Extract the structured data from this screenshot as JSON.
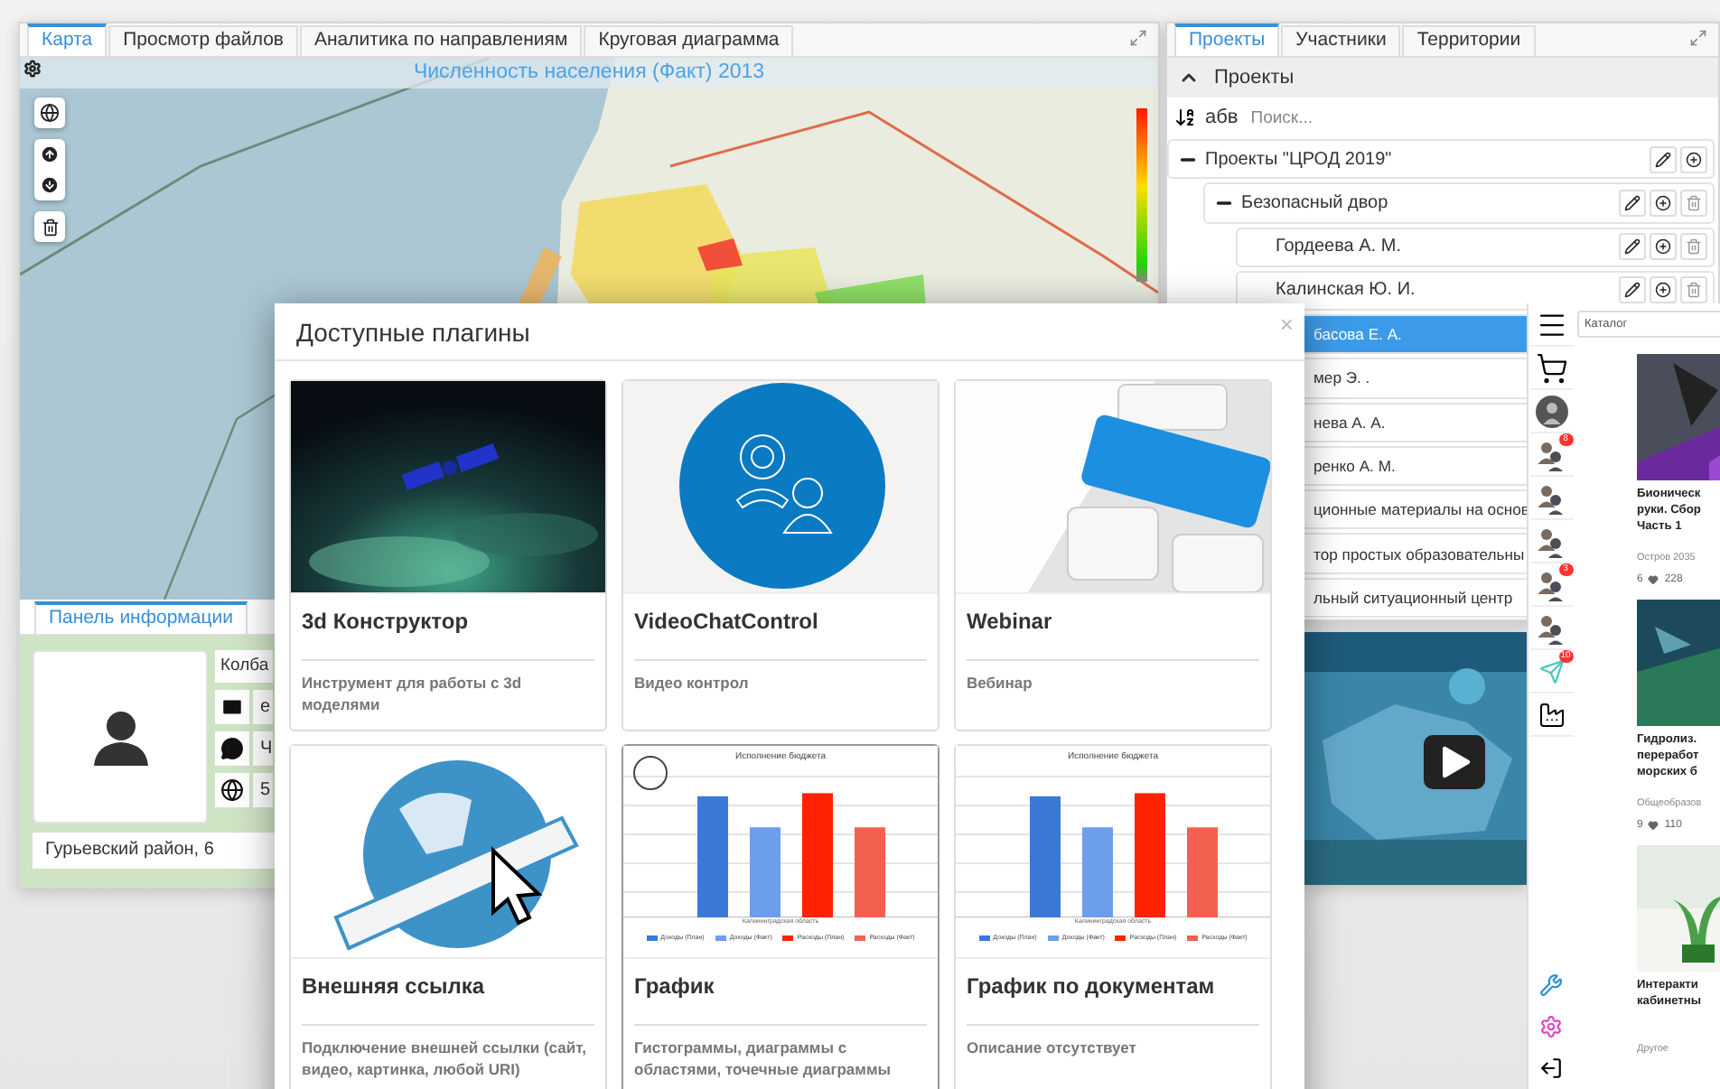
{
  "left_window": {
    "tabs": [
      {
        "label": "Карта",
        "selected": true
      },
      {
        "label": "Просмотр файлов",
        "selected": false
      },
      {
        "label": "Аналитика по направлениям",
        "selected": false
      },
      {
        "label": "Круговая диаграмма",
        "selected": false
      }
    ],
    "map": {
      "title": "Численность населения (Факт) 2013"
    },
    "info_panel": {
      "tab": "Панель информации",
      "name": "Колба",
      "fields": [
        {
          "kind": "email",
          "value": "e"
        },
        {
          "kind": "chat",
          "value": "Ч"
        },
        {
          "kind": "web",
          "value": "5"
        }
      ],
      "address": "Гурьевский район, 6"
    }
  },
  "right_window": {
    "tabs": [
      {
        "label": "Проекты",
        "selected": true
      },
      {
        "label": "Участники",
        "selected": false
      },
      {
        "label": "Территории",
        "selected": false
      }
    ],
    "section": {
      "title": "Проекты",
      "expanded": true
    },
    "sort_label": "абв",
    "search": {
      "placeholder": "Поиск..."
    },
    "tree": [
      {
        "label": "Проекты \"ЦРОД 2019\"",
        "expanded": true,
        "selected": false,
        "children": [
          {
            "label": "Безопасный двор",
            "expanded": true,
            "selected": false,
            "children": [
              {
                "label": "Гордеева А. М.",
                "selected": false
              },
              {
                "label": "Калинская Ю. И.",
                "selected": false
              },
              {
                "label": "басова Е. А.",
                "selected": true
              },
              {
                "label": "мер Э. .",
                "selected": false
              },
              {
                "label": "нева А. А.",
                "selected": false
              },
              {
                "label": "ренко А. М.",
                "selected": false
              }
            ]
          },
          {
            "label": "ционные материалы на основ",
            "selected": false
          },
          {
            "label": "тор простых образовательны",
            "selected": false
          },
          {
            "label": "льный ситуационный центр",
            "selected": false
          }
        ]
      }
    ]
  },
  "app_strip": {
    "nav": [
      {
        "kind": "menu"
      },
      {
        "kind": "cart"
      },
      {
        "kind": "avatar"
      },
      {
        "kind": "group",
        "badge": "8"
      },
      {
        "kind": "group"
      },
      {
        "kind": "group"
      },
      {
        "kind": "group",
        "badge": "3"
      },
      {
        "kind": "group"
      },
      {
        "kind": "send",
        "badge": "10"
      },
      {
        "kind": "factory"
      }
    ],
    "bottom": [
      {
        "kind": "tools"
      },
      {
        "kind": "settings"
      },
      {
        "kind": "logout"
      }
    ]
  },
  "catalog": {
    "search": {
      "placeholder": "Каталог"
    },
    "cards": [
      {
        "kind": "robot",
        "title": "Бионическ\nруки. Сбор\nЧасть 1",
        "category": "Остров 2035",
        "count": "6",
        "likes": "228"
      },
      {
        "kind": "sea",
        "title": "Гидролиз.\nпереработ\nморских б",
        "category": "Общеобразов",
        "count": "9",
        "likes": "110"
      },
      {
        "kind": "plants",
        "title": "Интеракти\nкабинетны",
        "category": "Другое"
      }
    ]
  },
  "modal": {
    "title": "Доступные плагины",
    "close": "×",
    "plugins": [
      {
        "kind": "space",
        "hovered": false,
        "title": "3d Конструктор",
        "description": "Инструмент для работы с 3d моделями"
      },
      {
        "kind": "videochat",
        "hovered": false,
        "title": "VideoChatControl",
        "description": "Видео контрол"
      },
      {
        "kind": "webinar",
        "hovered": false,
        "title": "Webinar",
        "description": "Вебинар"
      },
      {
        "kind": "link",
        "hovered": false,
        "title": "Внешняя ссылка",
        "description": "Подключение внешней ссылки (сайт, видео, картинка, любой URI)"
      },
      {
        "kind": "chart",
        "hovered": true,
        "title": "График",
        "description": "Гистограммы, диаграммы с областями, точечные диаграммы",
        "preview": {
          "title": "Исполнение бюджета",
          "category": "Калининградская область",
          "legend": [
            {
              "name": "Доходы (План)",
              "color": "#3c78d8"
            },
            {
              "name": "Доходы (Факт)",
              "color": "#6d9eeb"
            },
            {
              "name": "Расходы (План)",
              "color": "#ff2200"
            },
            {
              "name": "Расходы (Факт)",
              "color": "#f4604f"
            }
          ]
        }
      },
      {
        "kind": "chart",
        "hovered": false,
        "title": "График по документам",
        "description": "Описание отсутствует",
        "preview": {
          "title": "Исполнение бюджета",
          "category": "Калининградская область",
          "legend": [
            {
              "name": "Доходы (План)",
              "color": "#3c78d8"
            },
            {
              "name": "Доходы (Факт)",
              "color": "#6d9eeb"
            },
            {
              "name": "Расходы (План)",
              "color": "#ff2200"
            },
            {
              "name": "Расходы (Факт)",
              "color": "#f4604f"
            }
          ]
        }
      }
    ]
  }
}
